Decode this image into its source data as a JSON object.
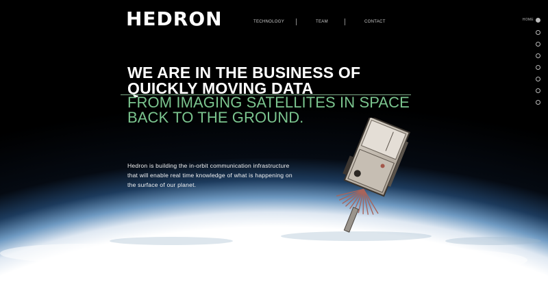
{
  "brand": {
    "logo": "HEDRON"
  },
  "nav": {
    "items": [
      {
        "label": "TECHNOLOGY"
      },
      {
        "label": "TEAM"
      },
      {
        "label": "CONTACT"
      }
    ]
  },
  "side_nav": {
    "active_label": "HOME",
    "dot_count": 7
  },
  "hero": {
    "headline_line1": "WE ARE IN THE BUSINESS OF",
    "headline_line2": "QUICKLY MOVING DATA",
    "subline_line1": "FROM IMAGING SATELLITES IN SPACE",
    "subline_line2": "BACK TO THE GROUND.",
    "body_line1": "Hedron is building the in-orbit communication infrastructure",
    "body_line2": "that will enable real time knowledge of what is happening on",
    "body_line3": "the surface of our planet."
  },
  "colors": {
    "background": "#000000",
    "accent_green": "#7bc58f",
    "text": "#ffffff"
  }
}
